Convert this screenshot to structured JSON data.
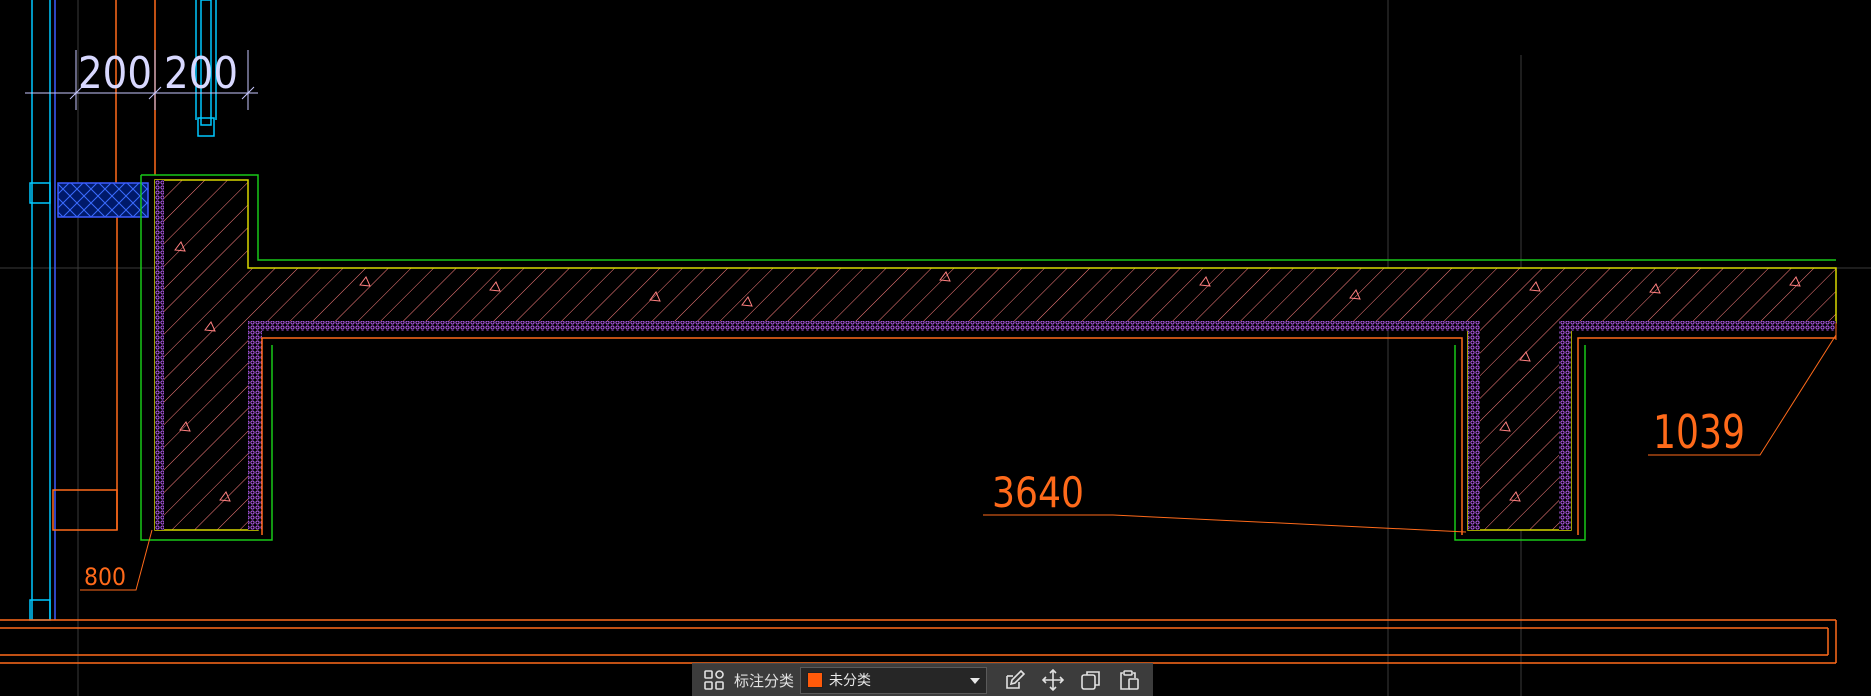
{
  "drawing": {
    "dim_left": "200",
    "dim_right": "200",
    "dim_800": "800",
    "dim_3640": "3640",
    "dim_1039": "1039"
  },
  "toolbar": {
    "category_label": "标注分类",
    "category_value": "未分类",
    "category_color": "#ff5a0a",
    "icons": [
      "grid-menu-icon",
      "edit-icon",
      "move-icon",
      "copy-icon",
      "paste-icon"
    ]
  },
  "colors": {
    "background": "#000000",
    "green": "#19c819",
    "orange": "#ff6a1a",
    "yellow": "#d8d800",
    "cyan": "#00c8ff",
    "magenta": "#d400d4",
    "hatch": "#ff8080",
    "dimension": "#c8c8ff"
  }
}
